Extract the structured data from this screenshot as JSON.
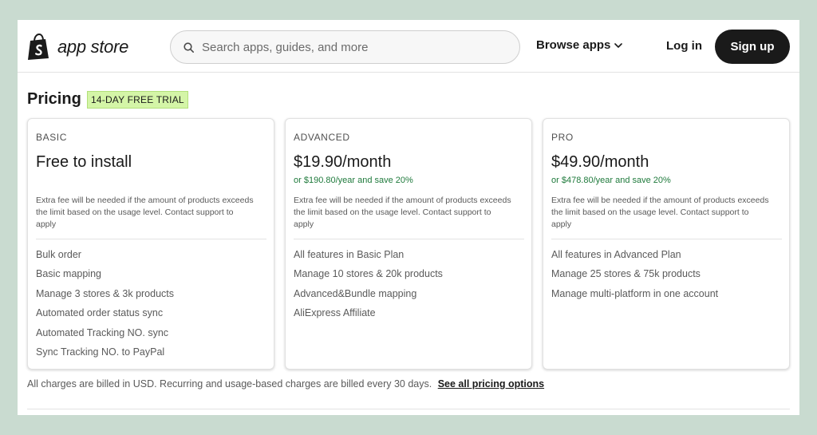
{
  "header": {
    "logo_text": "app store",
    "search_placeholder": "Search apps, guides, and more",
    "browse_label": "Browse apps",
    "login_label": "Log in",
    "signup_label": "Sign up"
  },
  "pricing": {
    "title": "Pricing",
    "badge": "14-DAY FREE TRIAL",
    "plans": [
      {
        "name": "BASIC",
        "price": "Free to install",
        "annual": "",
        "fee_note": "Extra fee will be needed if the amount of products exceeds the limit based on the usage level. Contact support to apply",
        "features": [
          "Bulk order",
          "Basic mapping",
          "Manage 3 stores & 3k products",
          "Automated order status sync",
          "Automated Tracking NO. sync",
          "Sync Tracking NO. to PayPal"
        ]
      },
      {
        "name": "ADVANCED",
        "price": "$19.90/month",
        "annual": "or $190.80/year and save 20%",
        "fee_note": "Extra fee will be needed if the amount of products exceeds the limit based on the usage level. Contact support to apply",
        "features": [
          "All features in Basic Plan",
          "Manage 10 stores & 20k products",
          "Advanced&Bundle mapping",
          "AliExpress Affiliate"
        ]
      },
      {
        "name": "PRO",
        "price": "$49.90/month",
        "annual": "or $478.80/year and save 20%",
        "fee_note": "Extra fee will be needed if the amount of products exceeds the limit based on the usage level. Contact support to apply",
        "features": [
          "All features in Advanced Plan",
          "Manage 25 stores & 75k products",
          "Manage multi-platform in one account"
        ]
      }
    ],
    "footnote": "All charges are billed in USD. Recurring and usage-based charges are billed every 30 days.",
    "see_all_link": "See all pricing options"
  },
  "colors": {
    "badge_bg": "#d4f5a7",
    "annual_text": "#1f7a3c",
    "signup_bg": "#1a1a1a",
    "page_bg": "#c9dbd0"
  },
  "icons": [
    "shopify-bag-icon",
    "search-icon",
    "chevron-down-icon"
  ]
}
